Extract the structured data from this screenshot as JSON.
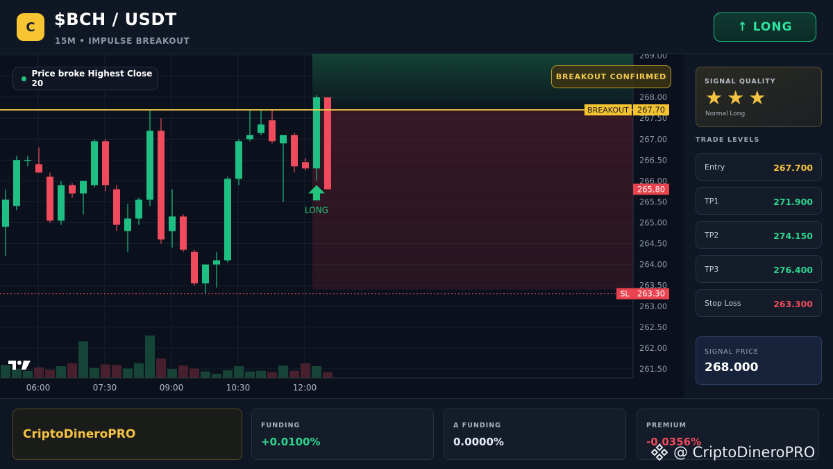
{
  "header": {
    "coin_letter": "C",
    "pair": "$BCH / USDT",
    "subtitle": "15M • IMPULSE BREAKOUT",
    "direction_button": "↑ LONG"
  },
  "chart": {
    "price_pill": "Price broke Highest Close 20",
    "badge": "BREAKOUT CONFIRMED",
    "signal_label": "LONG",
    "breakout_label": "BREAKOUT",
    "breakout_value": "267.70",
    "current_value": "265.80",
    "sl_label": "SL",
    "sl_value": "263.30",
    "watermark_logo": "TV"
  },
  "chart_data": {
    "type": "candlestick",
    "title": "",
    "ylim": [
      261.3,
      269.05
    ],
    "y_ticks": [
      "269.00",
      "268.50",
      "268.00",
      "267.50",
      "267.00",
      "266.50",
      "266.00",
      "265.50",
      "265.00",
      "264.50",
      "264.00",
      "263.50",
      "263.00",
      "262.50",
      "262.00",
      "261.50"
    ],
    "x_ticks": [
      "06:00",
      "07:30",
      "09:00",
      "10:30",
      "12:00"
    ],
    "levels": {
      "breakout": 267.7,
      "current": 265.8,
      "stop_loss": 263.3
    },
    "candles": [
      {
        "o": 264.9,
        "h": 265.8,
        "l": 264.2,
        "c": 265.55,
        "v": 0.22
      },
      {
        "o": 265.4,
        "h": 266.6,
        "l": 265.3,
        "c": 266.5,
        "v": 0.15
      },
      {
        "o": 266.5,
        "h": 266.6,
        "l": 266.35,
        "c": 266.5,
        "v": 0.12
      },
      {
        "o": 266.4,
        "h": 266.8,
        "l": 266.2,
        "c": 266.2,
        "v": 0.18
      },
      {
        "o": 266.1,
        "h": 266.2,
        "l": 265.0,
        "c": 265.05,
        "v": 0.14
      },
      {
        "o": 265.05,
        "h": 266.0,
        "l": 264.95,
        "c": 265.9,
        "v": 0.2
      },
      {
        "o": 265.9,
        "h": 265.95,
        "l": 265.6,
        "c": 265.7,
        "v": 0.25
      },
      {
        "o": 265.7,
        "h": 266.0,
        "l": 265.2,
        "c": 266.0,
        "v": 0.62
      },
      {
        "o": 265.9,
        "h": 267.0,
        "l": 265.85,
        "c": 266.95,
        "v": 0.17
      },
      {
        "o": 266.95,
        "h": 267.0,
        "l": 265.75,
        "c": 265.9,
        "v": 0.23
      },
      {
        "o": 265.8,
        "h": 265.9,
        "l": 264.8,
        "c": 264.95,
        "v": 0.22
      },
      {
        "o": 264.8,
        "h": 265.45,
        "l": 264.3,
        "c": 265.1,
        "v": 0.16
      },
      {
        "o": 265.1,
        "h": 265.6,
        "l": 264.95,
        "c": 265.55,
        "v": 0.25
      },
      {
        "o": 265.55,
        "h": 267.7,
        "l": 265.4,
        "c": 267.2,
        "v": 0.72
      },
      {
        "o": 267.2,
        "h": 267.5,
        "l": 264.5,
        "c": 264.6,
        "v": 0.33
      },
      {
        "o": 264.8,
        "h": 265.8,
        "l": 264.4,
        "c": 265.15,
        "v": 0.15
      },
      {
        "o": 265.15,
        "h": 265.2,
        "l": 264.3,
        "c": 264.35,
        "v": 0.21
      },
      {
        "o": 264.3,
        "h": 264.35,
        "l": 263.5,
        "c": 263.55,
        "v": 0.16
      },
      {
        "o": 263.55,
        "h": 264.0,
        "l": 263.3,
        "c": 264.0,
        "v": 0.11
      },
      {
        "o": 264.0,
        "h": 264.3,
        "l": 263.45,
        "c": 264.1,
        "v": 0.07
      },
      {
        "o": 264.1,
        "h": 266.1,
        "l": 264.05,
        "c": 266.05,
        "v": 0.13
      },
      {
        "o": 266.05,
        "h": 267.0,
        "l": 265.9,
        "c": 266.95,
        "v": 0.2
      },
      {
        "o": 267.0,
        "h": 267.7,
        "l": 266.95,
        "c": 267.1,
        "v": 0.11
      },
      {
        "o": 267.15,
        "h": 267.7,
        "l": 267.1,
        "c": 267.35,
        "v": 0.12
      },
      {
        "o": 267.45,
        "h": 267.7,
        "l": 266.9,
        "c": 266.95,
        "v": 0.1
      },
      {
        "o": 266.9,
        "h": 267.1,
        "l": 265.5,
        "c": 267.1,
        "v": 0.21
      },
      {
        "o": 267.1,
        "h": 267.15,
        "l": 266.2,
        "c": 266.35,
        "v": 0.12
      },
      {
        "o": 266.45,
        "h": 266.55,
        "l": 266.25,
        "c": 266.3,
        "v": 0.25
      },
      {
        "o": 266.3,
        "h": 268.05,
        "l": 266.0,
        "c": 268.0,
        "v": 0.2
      },
      {
        "o": 268.0,
        "h": 268.0,
        "l": 265.8,
        "c": 265.8,
        "v": 0.1
      }
    ]
  },
  "panel": {
    "quality_title": "SIGNAL QUALITY",
    "quality_stars": 3,
    "star_glyph": "★",
    "quality_sub": "Normal Long",
    "levels_title": "TRADE LEVELS",
    "levels": [
      {
        "label": "Entry",
        "value": "267.700",
        "color": "#f6c23e"
      },
      {
        "label": "TP1",
        "value": "271.900",
        "color": "#2ed58e"
      },
      {
        "label": "TP2",
        "value": "274.150",
        "color": "#2ed58e"
      },
      {
        "label": "TP3",
        "value": "276.400",
        "color": "#2ed58e"
      },
      {
        "label": "Stop Loss",
        "value": "263.300",
        "color": "#f04b5d"
      }
    ],
    "signal_price_title": "SIGNAL PRICE",
    "signal_price": "268.000"
  },
  "bottom": {
    "brand": "CriptoDineroPRO",
    "stats": [
      {
        "title": "FUNDING",
        "value": "+0.0100%",
        "color": "#2ed58e"
      },
      {
        "title": "Δ FUNDING",
        "value": "0.0000%",
        "color": "#e6ebf2"
      },
      {
        "title": "PREMIUM",
        "value": "-0.0356%",
        "color": "#f04b5d"
      }
    ],
    "watermark": "@ CriptoDineroPRO"
  },
  "colors": {
    "up": "#1fbf84",
    "down": "#f04b5d",
    "accent": "#f5c343"
  }
}
